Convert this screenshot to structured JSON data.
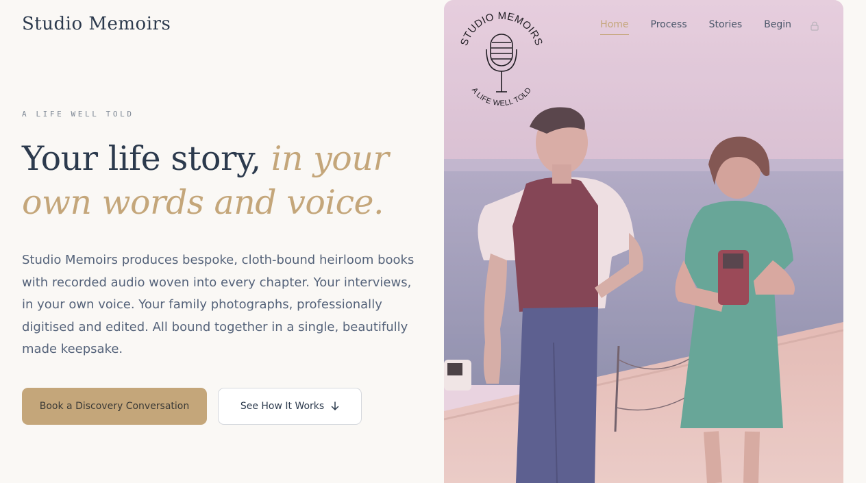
{
  "brand": {
    "name": "Studio Memoirs"
  },
  "hero": {
    "eyebrow": "A LIFE WELL TOLD",
    "headline_main": "Your life story, ",
    "headline_accent": "in your own words and voice.",
    "lede": "Studio Memoirs produces bespoke, cloth-bound heirloom books with recorded audio woven into every chapter. Your interviews, in your own voice. Your family photographs, professionally digitised and edited. All bound together in a single, beautifully made keepsake.",
    "primary_cta": "Book a Discovery Conversation",
    "secondary_cta": "See How It Works"
  },
  "nav": {
    "items": [
      {
        "label": "Home",
        "active": true
      },
      {
        "label": "Process",
        "active": false
      },
      {
        "label": "Stories",
        "active": false
      },
      {
        "label": "Begin",
        "active": false
      }
    ],
    "lock_icon": "lock-icon"
  },
  "logo": {
    "top_text": "STUDIO MEMOIRS",
    "bottom_text": "A LIFE WELL TOLD",
    "icon": "microphone-icon"
  },
  "colors": {
    "accent": "#c4a67a",
    "navy": "#2c3a4d",
    "background": "#faf8f5"
  }
}
